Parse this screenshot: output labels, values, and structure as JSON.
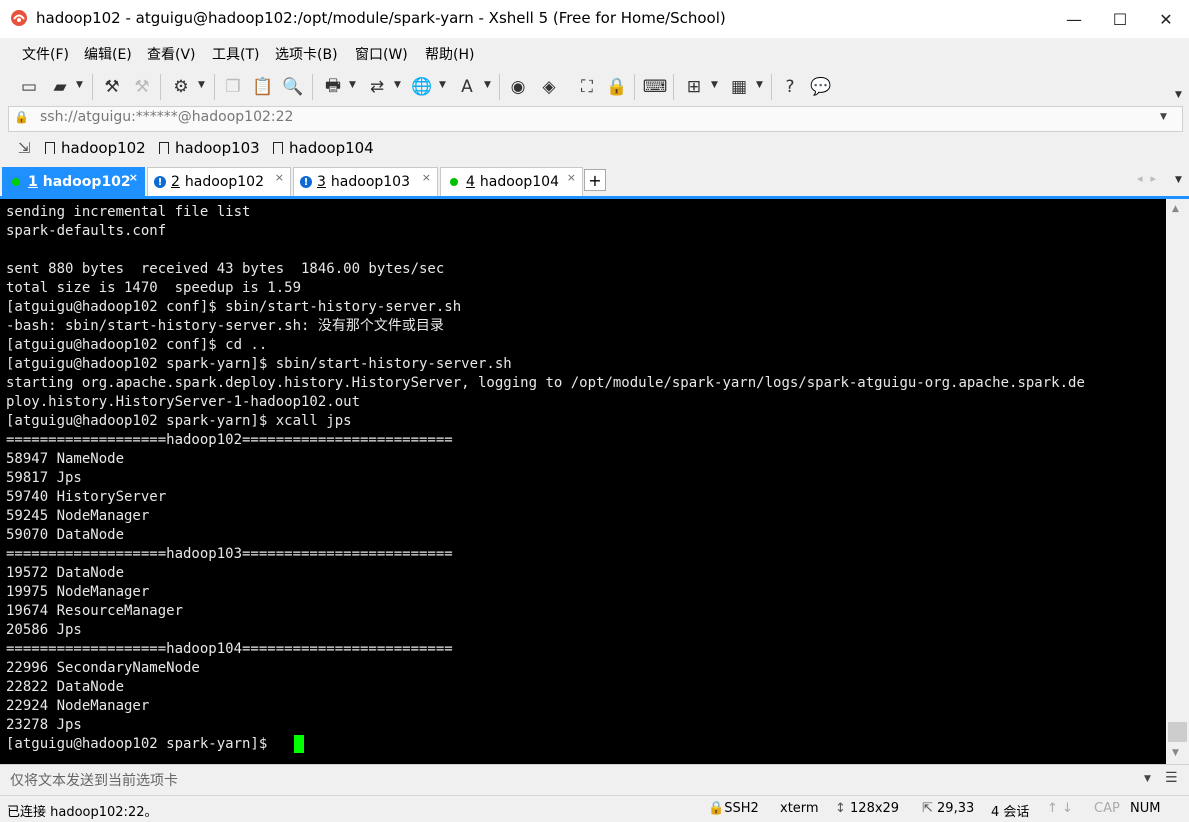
{
  "window": {
    "title": "hadoop102 - atguigu@hadoop102:/opt/module/spark-yarn - Xshell 5 (Free for Home/School)",
    "minimize": "—",
    "maximize": "☐",
    "close": "✕"
  },
  "menu": [
    "文件(F)",
    "编辑(E)",
    "查看(V)",
    "工具(T)",
    "选项卡(B)",
    "窗口(W)",
    "帮助(H)"
  ],
  "address": {
    "value": "ssh://atguigu:******@hadoop102:22"
  },
  "quick_sessions": [
    "hadoop102",
    "hadoop103",
    "hadoop104"
  ],
  "tabs": [
    {
      "num": "1",
      "label": "hadoop102",
      "status_color": "#00c000"
    },
    {
      "num": "2",
      "label": "hadoop102",
      "status": "!"
    },
    {
      "num": "3",
      "label": "hadoop103",
      "status": "!"
    },
    {
      "num": "4",
      "label": "hadoop104",
      "status_color": "#00c000"
    }
  ],
  "tab_close": "×",
  "tab_add": "+",
  "terminal": {
    "lines": [
      "sending incremental file list",
      "spark-defaults.conf",
      "",
      "sent 880 bytes  received 43 bytes  1846.00 bytes/sec",
      "total size is 1470  speedup is 1.59",
      "[atguigu@hadoop102 conf]$ sbin/start-history-server.sh",
      "-bash: sbin/start-history-server.sh: 没有那个文件或目录",
      "[atguigu@hadoop102 conf]$ cd ..",
      "[atguigu@hadoop102 spark-yarn]$ sbin/start-history-server.sh",
      "starting org.apache.spark.deploy.history.HistoryServer, logging to /opt/module/spark-yarn/logs/spark-atguigu-org.apache.spark.de",
      "ploy.history.HistoryServer-1-hadoop102.out",
      "[atguigu@hadoop102 spark-yarn]$ xcall jps",
      "===================hadoop102=========================",
      "58947 NameNode",
      "59817 Jps",
      "59740 HistoryServer",
      "59245 NodeManager",
      "59070 DataNode",
      "===================hadoop103=========================",
      "19572 DataNode",
      "19975 NodeManager",
      "19674 ResourceManager",
      "20586 Jps",
      "===================hadoop104=========================",
      "22996 SecondaryNameNode",
      "22822 DataNode",
      "22924 NodeManager",
      "23278 Jps",
      "[atguigu@hadoop102 spark-yarn]$ "
    ]
  },
  "sendbar": {
    "placeholder": "仅将文本发送到当前选项卡"
  },
  "status": {
    "connection": "已连接 hadoop102:22。",
    "protocol": "SSH2",
    "term_type": "xterm",
    "size": "128x29",
    "cursor_pos": "29,33",
    "sessions": "4 会话",
    "cap": "CAP",
    "num": "NUM"
  }
}
